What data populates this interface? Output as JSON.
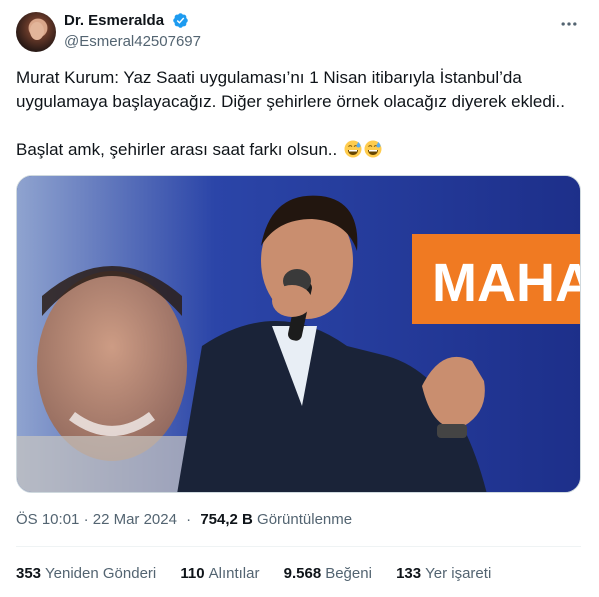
{
  "author": {
    "display_name": "Dr. Esmeralda",
    "handle": "@Esmeral42507697",
    "verified_icon": "verified-badge-icon",
    "accent_color": "#1d9bf0"
  },
  "tweet": {
    "line1": "Murat Kurum: Yaz Saati uygulaması’nı 1 Nisan itibarıyla İstanbul’da",
    "line2": "uygulamaya başlayacağız. Diğer şehirlere örnek olacağız diyerek ekledi..",
    "line3": "Başlat amk, şehirler arası saat farkı olsun..",
    "emojis": [
      "sweat-smile-emoji",
      "sweat-smile-emoji"
    ]
  },
  "media": {
    "banner_text": "MAHA"
  },
  "meta": {
    "time": "ÖS 10:01",
    "separator": "·",
    "date": "22 Mar 2024",
    "views_count": "754,2 B",
    "views_label": "Görüntülenme"
  },
  "stats": [
    {
      "count": "353",
      "label": "Yeniden Gönderi"
    },
    {
      "count": "110",
      "label": "Alıntılar"
    },
    {
      "count": "9.568",
      "label": "Beğeni"
    },
    {
      "count": "133",
      "label": "Yer işareti"
    }
  ]
}
